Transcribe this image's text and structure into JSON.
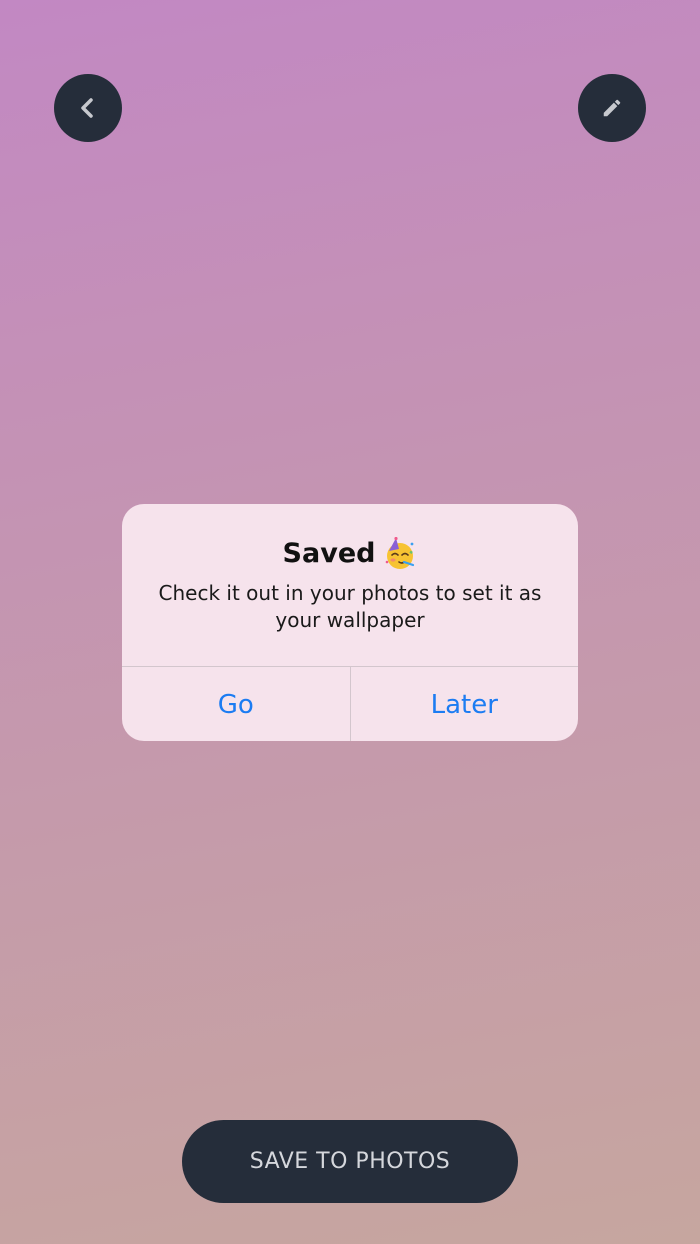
{
  "top_bar": {
    "back_icon": "chevron-left-icon",
    "edit_icon": "pencil-icon"
  },
  "alert": {
    "title": "Saved",
    "title_emoji": "partying-face-emoji",
    "message": "Check it out in your photos to set it as your wallpaper",
    "actions": [
      {
        "label": "Go"
      },
      {
        "label": "Later"
      }
    ],
    "action_color": "#1c7cf2"
  },
  "bottom": {
    "save_label": "SAVE TO PHOTOS"
  },
  "colors": {
    "button_bg": "#252d3a",
    "alert_bg": "#f6e3ec"
  }
}
